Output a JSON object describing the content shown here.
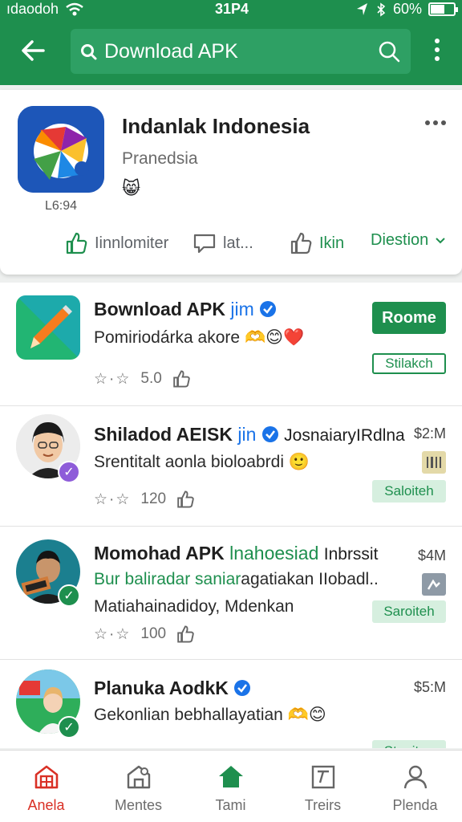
{
  "status_bar": {
    "carrier": "ıdaodoh",
    "time": "31P4",
    "battery": "60%",
    "battery_fraction": 0.6
  },
  "search": {
    "query": "Download APK"
  },
  "app_header": {
    "name": "Indanlak Indonesia",
    "developer": "Pranedsia",
    "emoji": "😸",
    "code": "L6:94",
    "actions": [
      {
        "label": "Iinnlomiter",
        "icon": "thumbs-up-icon"
      },
      {
        "label": "lat...",
        "icon": "comment-icon"
      },
      {
        "label": "Ikin",
        "icon": "thumbs-up-icon"
      },
      {
        "label": "Diestion",
        "icon": "chevron-down-icon"
      }
    ]
  },
  "items": [
    {
      "title": "Bownload APK",
      "tag": "jim",
      "verified": true,
      "desc": "Pomiriodárka akore",
      "desc_emoji": "🫶😊❤️",
      "rating_count": "5.0",
      "button_primary": "Roome",
      "button_secondary": "Stilakch"
    },
    {
      "title": "Shiladod AEISK",
      "tag": "jin",
      "verified": true,
      "title_rest": "JosnaiaryIRdlna",
      "desc": "Srentitalt aonla bioloabrdi",
      "desc_emoji": "🙂",
      "rating_count": "120",
      "price": "$2:M",
      "button": "Saloiteh"
    },
    {
      "title": "Momohad APK",
      "tag": "lnahoesiad",
      "title_rest": "Inbrssit",
      "desc": "Bur baliradar saniar",
      "desc_rest": "agatiakan IIobadl..",
      "desc2": "Matiahainadidoy, Mdenkan",
      "rating_count": "100",
      "price": "$4M",
      "button": "Saroiteh"
    },
    {
      "title": "Planuka AodkK",
      "verified": true,
      "desc": "Gekonlian bebhallayatian",
      "desc_emoji": "🫶😊",
      "price": "$5:M",
      "button": "Stapiten"
    }
  ],
  "bottom_nav": [
    {
      "label": "Anela",
      "icon": "store-icon",
      "active": true
    },
    {
      "label": "Mentes",
      "icon": "apps-icon",
      "active": false
    },
    {
      "label": "Tami",
      "icon": "home-icon",
      "active": false
    },
    {
      "label": "Treirs",
      "icon": "chart-icon",
      "active": false
    },
    {
      "label": "Plenda",
      "icon": "profile-icon",
      "active": false
    }
  ],
  "colors": {
    "primary": "#1e8f4e",
    "accent_blue": "#1a73e8",
    "active_nav": "#d93025"
  }
}
